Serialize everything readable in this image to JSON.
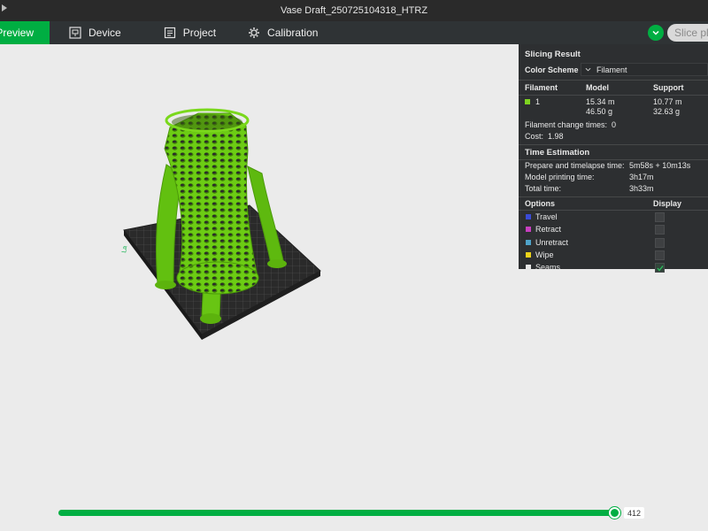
{
  "window": {
    "title": "Vase Draft_250725104318_HTRZ"
  },
  "tabs": {
    "preview": "Preview",
    "device": "Device",
    "project": "Project",
    "calibration": "Calibration"
  },
  "toolbar": {
    "slice_label": "Slice pla"
  },
  "panel": {
    "title": "Slicing Result",
    "color_scheme_label": "Color Scheme",
    "color_scheme_value": "Filament",
    "filament_header": "Filament",
    "model_header": "Model",
    "support_header": "Support",
    "filament": {
      "id": "1",
      "color": "#7ed321",
      "model_length": "15.34 m",
      "model_weight": "46.50 g",
      "support_length": "10.77 m",
      "support_weight": "32.63 g"
    },
    "filament_change_label": "Filament change times:",
    "filament_change_value": "0",
    "cost_label": "Cost:",
    "cost_value": "1.98",
    "time_title": "Time Estimation",
    "prepare_label": "Prepare and timelapse time:",
    "prepare_value": "5m58s + 10m13s",
    "model_time_label": "Model printing time:",
    "model_time_value": "3h17m",
    "total_time_label": "Total time:",
    "total_time_value": "3h33m",
    "options_header": "Options",
    "display_header": "Display",
    "options": [
      {
        "label": "Travel",
        "color": "#3a4bd6",
        "checked": false
      },
      {
        "label": "Retract",
        "color": "#c83fc0",
        "checked": false
      },
      {
        "label": "Unretract",
        "color": "#4fa3c9",
        "checked": false
      },
      {
        "label": "Wipe",
        "color": "#ecd21a",
        "checked": false
      },
      {
        "label": "Seams",
        "color": "#e6e6e6",
        "checked": true
      }
    ]
  },
  "slider": {
    "value": "412"
  },
  "colors": {
    "accent": "#00ae42",
    "model": "#6ccc14"
  }
}
